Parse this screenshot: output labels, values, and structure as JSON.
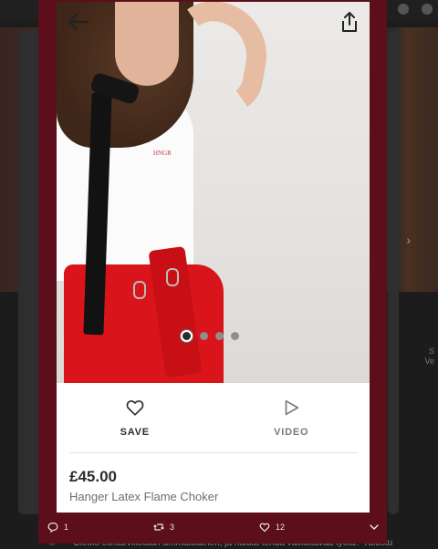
{
  "toolbar": {
    "back_icon": "back-arrow-icon",
    "share_icon": "share-icon"
  },
  "gallery": {
    "image_count": 4,
    "active_index": 0,
    "image_text": "HNGR"
  },
  "actions": {
    "save_label": "SAVE",
    "save_icon": "heart-icon",
    "video_label": "VIDEO",
    "video_icon": "play-icon"
  },
  "product": {
    "price": "£45.00",
    "name": "Hanger Latex Flame Choker"
  },
  "tweet": {
    "replies": "1",
    "retweets": "3",
    "likes": "12",
    "more_icon": "chevron-down-icon"
  },
  "background": {
    "text": "Oletko elintarvikealan ammattilainen, ja haluat tehdä vaikuttavaa työtä? Tulustu",
    "side_text_1": "S",
    "side_text_2": "Ve"
  },
  "colors": {
    "frame": "#5c0e1a",
    "skirt_red": "#d9141b",
    "text_dark": "#2d2d2d",
    "text_muted": "#6e6e6e"
  }
}
